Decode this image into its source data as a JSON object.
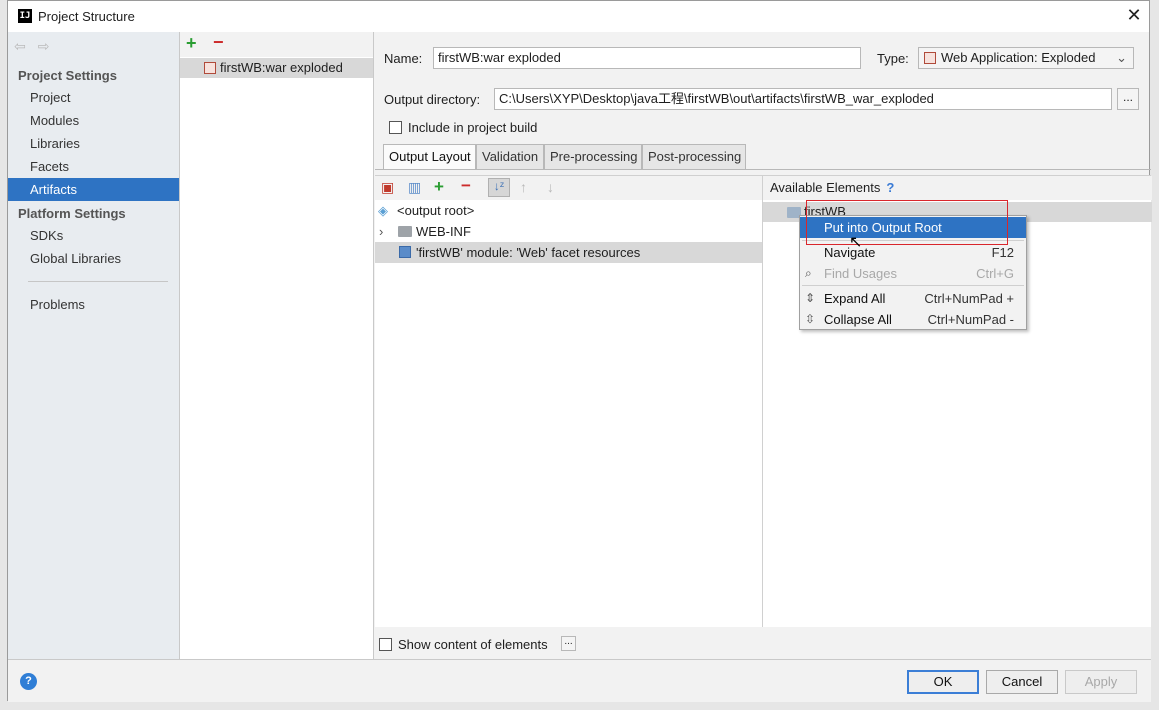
{
  "window": {
    "title": "Project Structure",
    "close": "✕"
  },
  "sidebar": {
    "project_settings": "Project Settings",
    "project_items": [
      "Project",
      "Modules",
      "Libraries",
      "Facets",
      "Artifacts"
    ],
    "selected": "Artifacts",
    "platform_settings": "Platform Settings",
    "platform_items": [
      "SDKs",
      "Global Libraries"
    ],
    "problems": "Problems"
  },
  "artifacts": {
    "add": "+",
    "remove": "−",
    "items": [
      "firstWB:war exploded"
    ]
  },
  "form": {
    "name_label": "Name:",
    "name_value": "firstWB:war exploded",
    "type_label": "Type:",
    "type_value": "Web Application: Exploded",
    "output_label": "Output directory:",
    "output_value": "C:\\Users\\XYP\\Desktop\\java工程\\firstWB\\out\\artifacts\\firstWB_war_exploded",
    "browse": "...",
    "include_label": "Include in project build"
  },
  "tabs": [
    "Output Layout",
    "Validation",
    "Pre-processing",
    "Post-processing"
  ],
  "layout": {
    "rows": [
      "<output root>",
      "WEB-INF",
      "'firstWB' module: 'Web' facet resources"
    ]
  },
  "available": {
    "header": "Available Elements",
    "help": "?",
    "row": "firstWB"
  },
  "context_menu": {
    "items": [
      {
        "label": "Put into Output Root",
        "shortcut": ""
      },
      {
        "label": "Navigate",
        "shortcut": "F12"
      },
      {
        "label": "Find Usages",
        "shortcut": "Ctrl+G"
      },
      {
        "label": "Expand All",
        "shortcut": "Ctrl+NumPad +"
      },
      {
        "label": "Collapse All",
        "shortcut": "Ctrl+NumPad -"
      }
    ]
  },
  "bottom": {
    "show_content": "Show content of elements",
    "more": "..."
  },
  "footer": {
    "help": "?",
    "ok": "OK",
    "cancel": "Cancel",
    "apply": "Apply"
  }
}
